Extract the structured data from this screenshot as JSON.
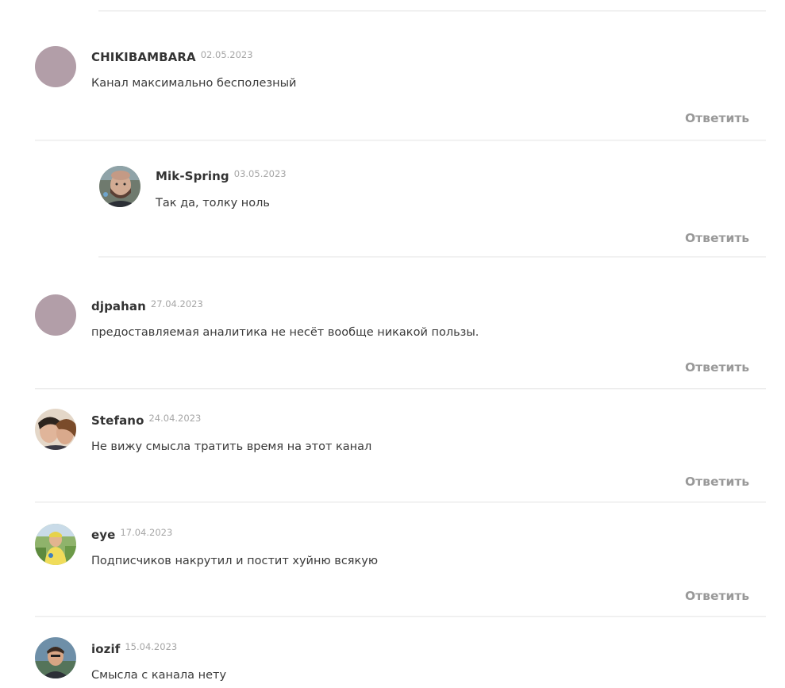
{
  "reply_label": "Ответить",
  "comments": [
    {
      "author": "CHIKIBAMBARA",
      "date": "02.05.2023",
      "text": "Канал максимально бесполезный",
      "avatar": "default-avatar"
    },
    {
      "author": "Mik-Spring",
      "date": "03.05.2023",
      "text": "Так да, толку ноль",
      "avatar": "user-photo",
      "is_reply": true
    },
    {
      "author": "djpahan",
      "date": "27.04.2023",
      "text": "предоставляемая аналитика не несёт вообще никакой пользы.",
      "avatar": "default-avatar"
    },
    {
      "author": "Stefano",
      "date": "24.04.2023",
      "text": "Не вижу смысла тратить время на этот канал",
      "avatar": "user-photo"
    },
    {
      "author": "eye",
      "date": "17.04.2023",
      "text": "Подписчиков накрутил и постит хуйню всякую",
      "avatar": "user-photo"
    },
    {
      "author": "iozif",
      "date": "15.04.2023",
      "text": "Смысла с канала нету",
      "avatar": "user-photo"
    }
  ],
  "colors": {
    "placeholder_avatar": "#b29ea8",
    "reply_link": "#999999",
    "date": "#a6a6a6",
    "divider": "#ececec"
  }
}
